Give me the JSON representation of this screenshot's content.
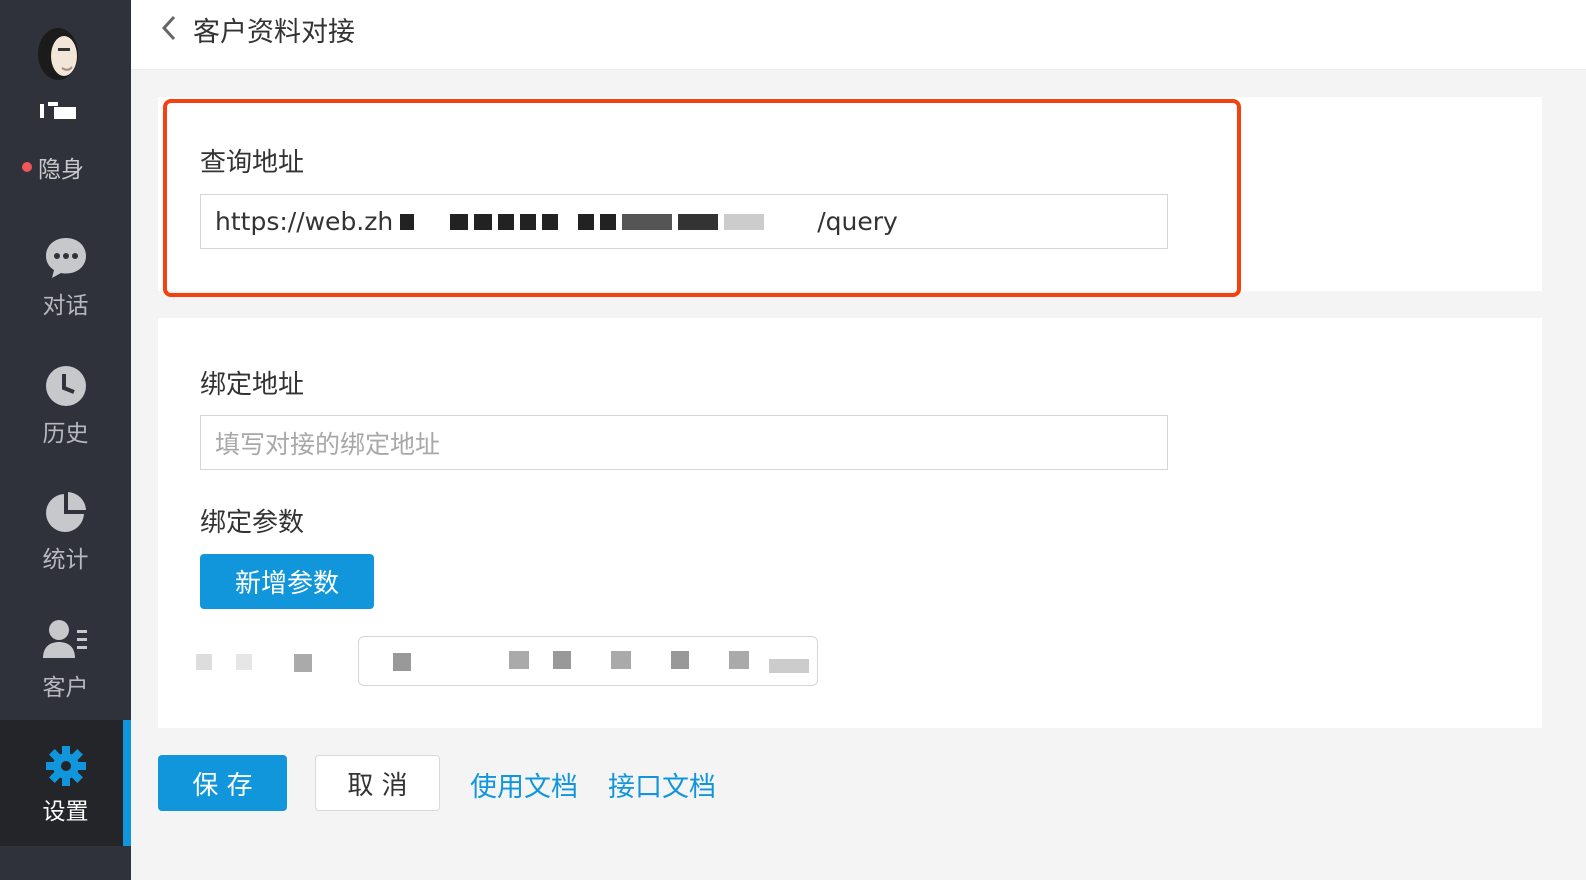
{
  "header": {
    "title": "客户资料对接"
  },
  "sidebar": {
    "username": "H",
    "status": "隐身",
    "items": [
      {
        "label": "对话",
        "icon": "chat-icon"
      },
      {
        "label": "历史",
        "icon": "clock-icon"
      },
      {
        "label": "统计",
        "icon": "pie-chart-icon"
      },
      {
        "label": "客户",
        "icon": "customer-icon"
      },
      {
        "label": "设置",
        "icon": "gear-icon",
        "active": true
      }
    ]
  },
  "query": {
    "label": "查询地址",
    "value_prefix": "https://web.zh",
    "value_suffix": "/query"
  },
  "bind": {
    "label": "绑定地址",
    "placeholder": "填写对接的绑定地址"
  },
  "params": {
    "label": "绑定参数",
    "add_button": "新增参数"
  },
  "actions": {
    "save": "保 存",
    "cancel": "取 消",
    "doc_usage": "使用文档",
    "doc_api": "接口文档"
  },
  "colors": {
    "accent": "#1296db",
    "highlight": "#f5400f",
    "sidebar": "#2f323a"
  }
}
